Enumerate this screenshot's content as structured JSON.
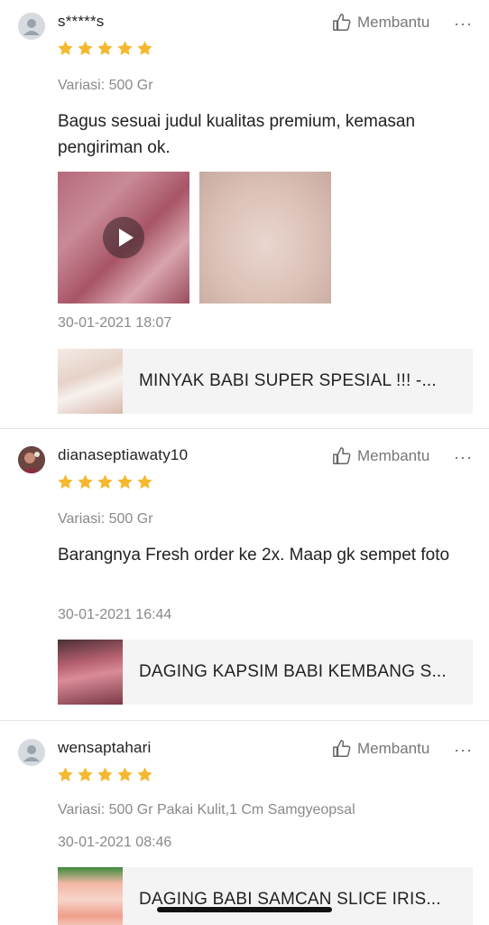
{
  "helpful_label": "Membantu",
  "more_glyph": "···",
  "colors": {
    "star": "#f5b82e",
    "muted_text": "#8a8a8a"
  },
  "reviews": [
    {
      "username": "s*****s",
      "rating": 5,
      "variant": "Variasi: 500 Gr",
      "comment": "Bagus sesuai judul kualitas premium, kemasan pengiriman ok.",
      "date": "30-01-2021 18:07",
      "product": "MINYAK BABI SUPER SPESIAL !!! -..."
    },
    {
      "username": "dianaseptiawaty10",
      "rating": 5,
      "variant": "Variasi: 500 Gr",
      "comment": "Barangnya Fresh order ke 2x. Maap gk sempet foto",
      "date": "30-01-2021 16:44",
      "product": "DAGING KAPSIM BABI KEMBANG S..."
    },
    {
      "username": "wensaptahari",
      "rating": 5,
      "variant": "Variasi: 500 Gr Pakai Kulit,1 Cm Samgyeopsal",
      "date": "30-01-2021 08:46",
      "product": "DAGING BABI SAMCAN SLICE IRIS..."
    }
  ]
}
